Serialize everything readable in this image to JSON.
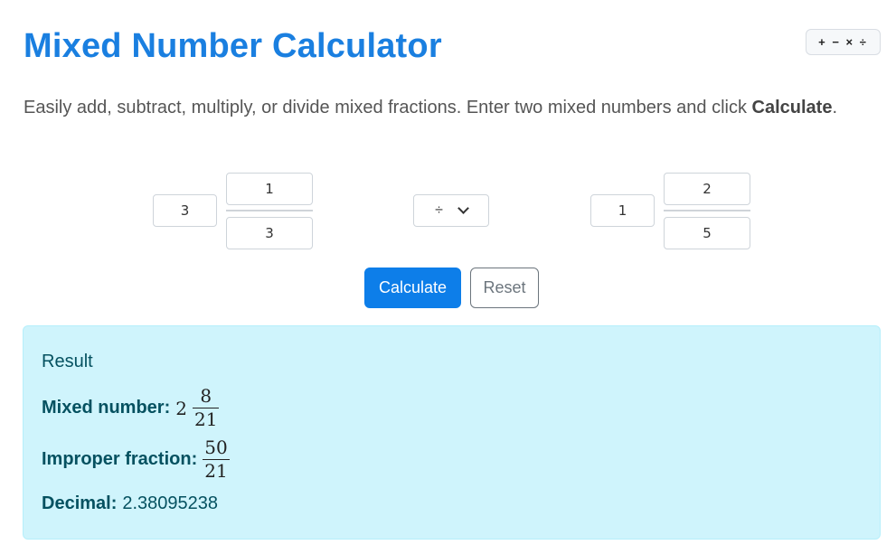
{
  "header": {
    "title": "Mixed Number Calculator",
    "ops_badge": "+ − × ÷"
  },
  "description": {
    "before": "Easily add, subtract, multiply, or divide mixed fractions. Enter two mixed numbers and click ",
    "bold": "Calculate",
    "after": "."
  },
  "first_number": {
    "whole": "3",
    "numerator": "1",
    "denominator": "3"
  },
  "operator": {
    "selected": "÷"
  },
  "second_number": {
    "whole": "1",
    "numerator": "2",
    "denominator": "5"
  },
  "buttons": {
    "calculate": "Calculate",
    "reset": "Reset"
  },
  "result": {
    "title": "Result",
    "mixed_label": "Mixed number:",
    "mixed_whole": "2",
    "mixed_num": "8",
    "mixed_den": "21",
    "improper_label": "Improper fraction:",
    "improper_num": "50",
    "improper_den": "21",
    "decimal_label": "Decimal:",
    "decimal_value": "2.38095238"
  },
  "colors": {
    "accent": "#1a7fe0",
    "primary_button": "#0d7ee9",
    "result_bg": "#cff4fc",
    "result_text": "#055160"
  }
}
